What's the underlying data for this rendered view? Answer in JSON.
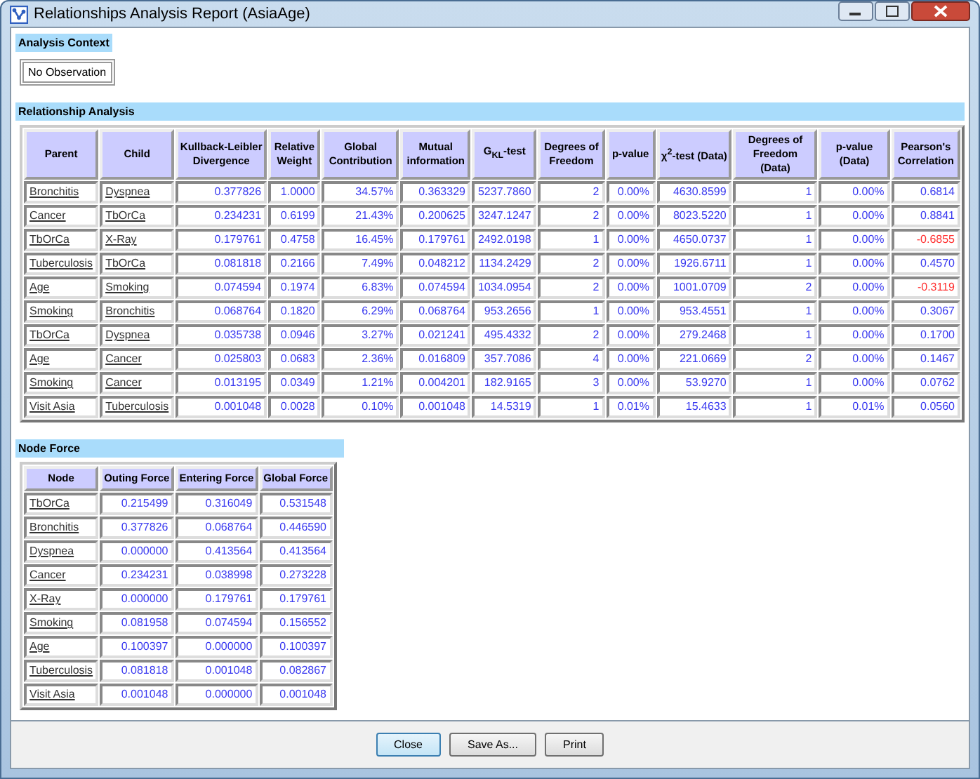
{
  "window": {
    "title": "Relationships Analysis Report (AsiaAge)"
  },
  "analysis_context": {
    "title": "Analysis Context",
    "value": "No Observation"
  },
  "relationship_analysis": {
    "title": "Relationship Analysis",
    "columns": [
      {
        "label": "Parent",
        "kind": "link"
      },
      {
        "label": "Child",
        "kind": "link"
      },
      {
        "label": "Kullback-Leibler Divergence",
        "kind": "number"
      },
      {
        "label": "Relative Weight",
        "kind": "number"
      },
      {
        "label": "Global Contribution",
        "kind": "number"
      },
      {
        "label": "Mutual information",
        "kind": "number"
      },
      {
        "label": "G$_{KL}$-test",
        "kind": "number"
      },
      {
        "label": "Degrees of Freedom",
        "kind": "number"
      },
      {
        "label": "p-value",
        "kind": "number"
      },
      {
        "label": "χ$^{2}$-test (Data)",
        "kind": "number"
      },
      {
        "label": "Degrees of Freedom (Data)",
        "kind": "number"
      },
      {
        "label": "p-value (Data)",
        "kind": "number"
      },
      {
        "label": "Pearson's Correlation",
        "kind": "correlation"
      }
    ],
    "rows": [
      {
        "cells": [
          "Bronchitis",
          "Dyspnea",
          "0.377826",
          "1.0000",
          "34.57%",
          "0.363329",
          "5237.7860",
          "2",
          "0.00%",
          "4630.8599",
          "1",
          "0.00%",
          "0.6814"
        ],
        "negative": false
      },
      {
        "cells": [
          "Cancer",
          "TbOrCa",
          "0.234231",
          "0.6199",
          "21.43%",
          "0.200625",
          "3247.1247",
          "2",
          "0.00%",
          "8023.5220",
          "1",
          "0.00%",
          "0.8841"
        ],
        "negative": false
      },
      {
        "cells": [
          "TbOrCa",
          "X-Ray",
          "0.179761",
          "0.4758",
          "16.45%",
          "0.179761",
          "2492.0198",
          "1",
          "0.00%",
          "4650.0737",
          "1",
          "0.00%",
          "-0.6855"
        ],
        "negative": true
      },
      {
        "cells": [
          "Tuberculosis",
          "TbOrCa",
          "0.081818",
          "0.2166",
          "7.49%",
          "0.048212",
          "1134.2429",
          "2",
          "0.00%",
          "1926.6711",
          "1",
          "0.00%",
          "0.4570"
        ],
        "negative": false
      },
      {
        "cells": [
          "Age",
          "Smoking",
          "0.074594",
          "0.1974",
          "6.83%",
          "0.074594",
          "1034.0954",
          "2",
          "0.00%",
          "1001.0709",
          "2",
          "0.00%",
          "-0.3119"
        ],
        "negative": true
      },
      {
        "cells": [
          "Smoking",
          "Bronchitis",
          "0.068764",
          "0.1820",
          "6.29%",
          "0.068764",
          "953.2656",
          "1",
          "0.00%",
          "953.4551",
          "1",
          "0.00%",
          "0.3067"
        ],
        "negative": false
      },
      {
        "cells": [
          "TbOrCa",
          "Dyspnea",
          "0.035738",
          "0.0946",
          "3.27%",
          "0.021241",
          "495.4332",
          "2",
          "0.00%",
          "279.2468",
          "1",
          "0.00%",
          "0.1700"
        ],
        "negative": false
      },
      {
        "cells": [
          "Age",
          "Cancer",
          "0.025803",
          "0.0683",
          "2.36%",
          "0.016809",
          "357.7086",
          "4",
          "0.00%",
          "221.0669",
          "2",
          "0.00%",
          "0.1467"
        ],
        "negative": false
      },
      {
        "cells": [
          "Smoking",
          "Cancer",
          "0.013195",
          "0.0349",
          "1.21%",
          "0.004201",
          "182.9165",
          "3",
          "0.00%",
          "53.9270",
          "1",
          "0.00%",
          "0.0762"
        ],
        "negative": false
      },
      {
        "cells": [
          "Visit Asia",
          "Tuberculosis",
          "0.001048",
          "0.0028",
          "0.10%",
          "0.001048",
          "14.5319",
          "1",
          "0.01%",
          "15.4633",
          "1",
          "0.01%",
          "0.0560"
        ],
        "negative": false
      }
    ]
  },
  "node_force": {
    "title": "Node Force",
    "columns": [
      {
        "label": "Node",
        "kind": "link"
      },
      {
        "label": "Outing Force",
        "kind": "number"
      },
      {
        "label": "Entering Force",
        "kind": "number"
      },
      {
        "label": "Global Force",
        "kind": "number"
      }
    ],
    "rows": [
      {
        "cells": [
          "TbOrCa",
          "0.215499",
          "0.316049",
          "0.531548"
        ]
      },
      {
        "cells": [
          "Bronchitis",
          "0.377826",
          "0.068764",
          "0.446590"
        ]
      },
      {
        "cells": [
          "Dyspnea",
          "0.000000",
          "0.413564",
          "0.413564"
        ]
      },
      {
        "cells": [
          "Cancer",
          "0.234231",
          "0.038998",
          "0.273228"
        ]
      },
      {
        "cells": [
          "X-Ray",
          "0.000000",
          "0.179761",
          "0.179761"
        ]
      },
      {
        "cells": [
          "Smoking",
          "0.081958",
          "0.074594",
          "0.156552"
        ]
      },
      {
        "cells": [
          "Age",
          "0.100397",
          "0.000000",
          "0.100397"
        ]
      },
      {
        "cells": [
          "Tuberculosis",
          "0.081818",
          "0.001048",
          "0.082867"
        ]
      },
      {
        "cells": [
          "Visit Asia",
          "0.001048",
          "0.000000",
          "0.001048"
        ]
      }
    ]
  },
  "buttons": [
    {
      "label": "Close",
      "default": true
    },
    {
      "label": "Save As...",
      "default": false
    },
    {
      "label": "Print",
      "default": false
    }
  ]
}
